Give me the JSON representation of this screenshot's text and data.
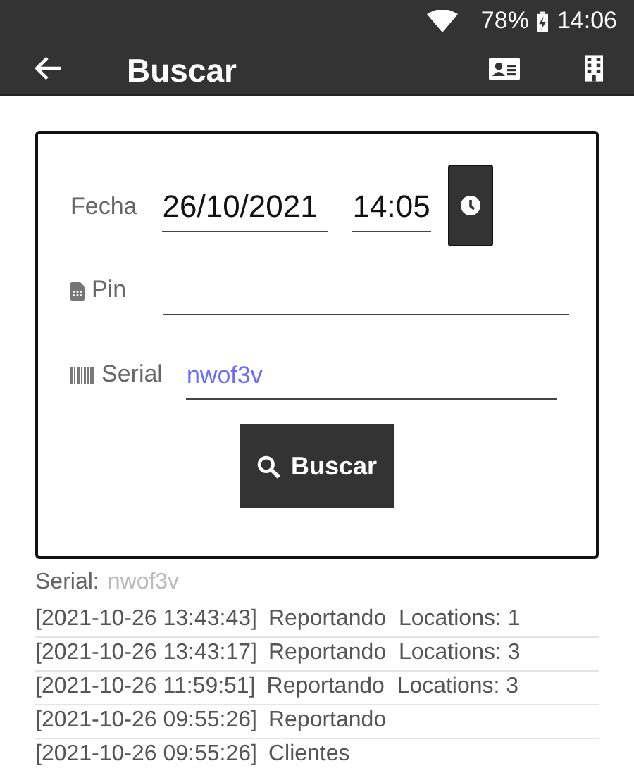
{
  "status_bar": {
    "battery": "78%",
    "time": "14:06"
  },
  "toolbar": {
    "title": "Buscar"
  },
  "form": {
    "date_label": "Fecha",
    "date": "26/10/2021",
    "time": "14:05",
    "pin_label": "Pin",
    "serial_label": "Serial",
    "serial": "nwof3v",
    "search_button": "Buscar"
  },
  "serial_line": {
    "label": "Serial:",
    "value": "nwof3v"
  },
  "log": [
    {
      "time": "[2021-10-26 13:43:43]",
      "text": "Reportando  Locations: 1"
    },
    {
      "time": "[2021-10-26 13:43:17]",
      "text": "Reportando  Locations: 3"
    },
    {
      "time": "[2021-10-26 11:59:51]",
      "text": "Reportando  Locations: 3"
    },
    {
      "time": "[2021-10-26 09:55:26]",
      "text": "Reportando"
    },
    {
      "time": "[2021-10-26 09:55:26]",
      "text": "Clientes"
    }
  ]
}
